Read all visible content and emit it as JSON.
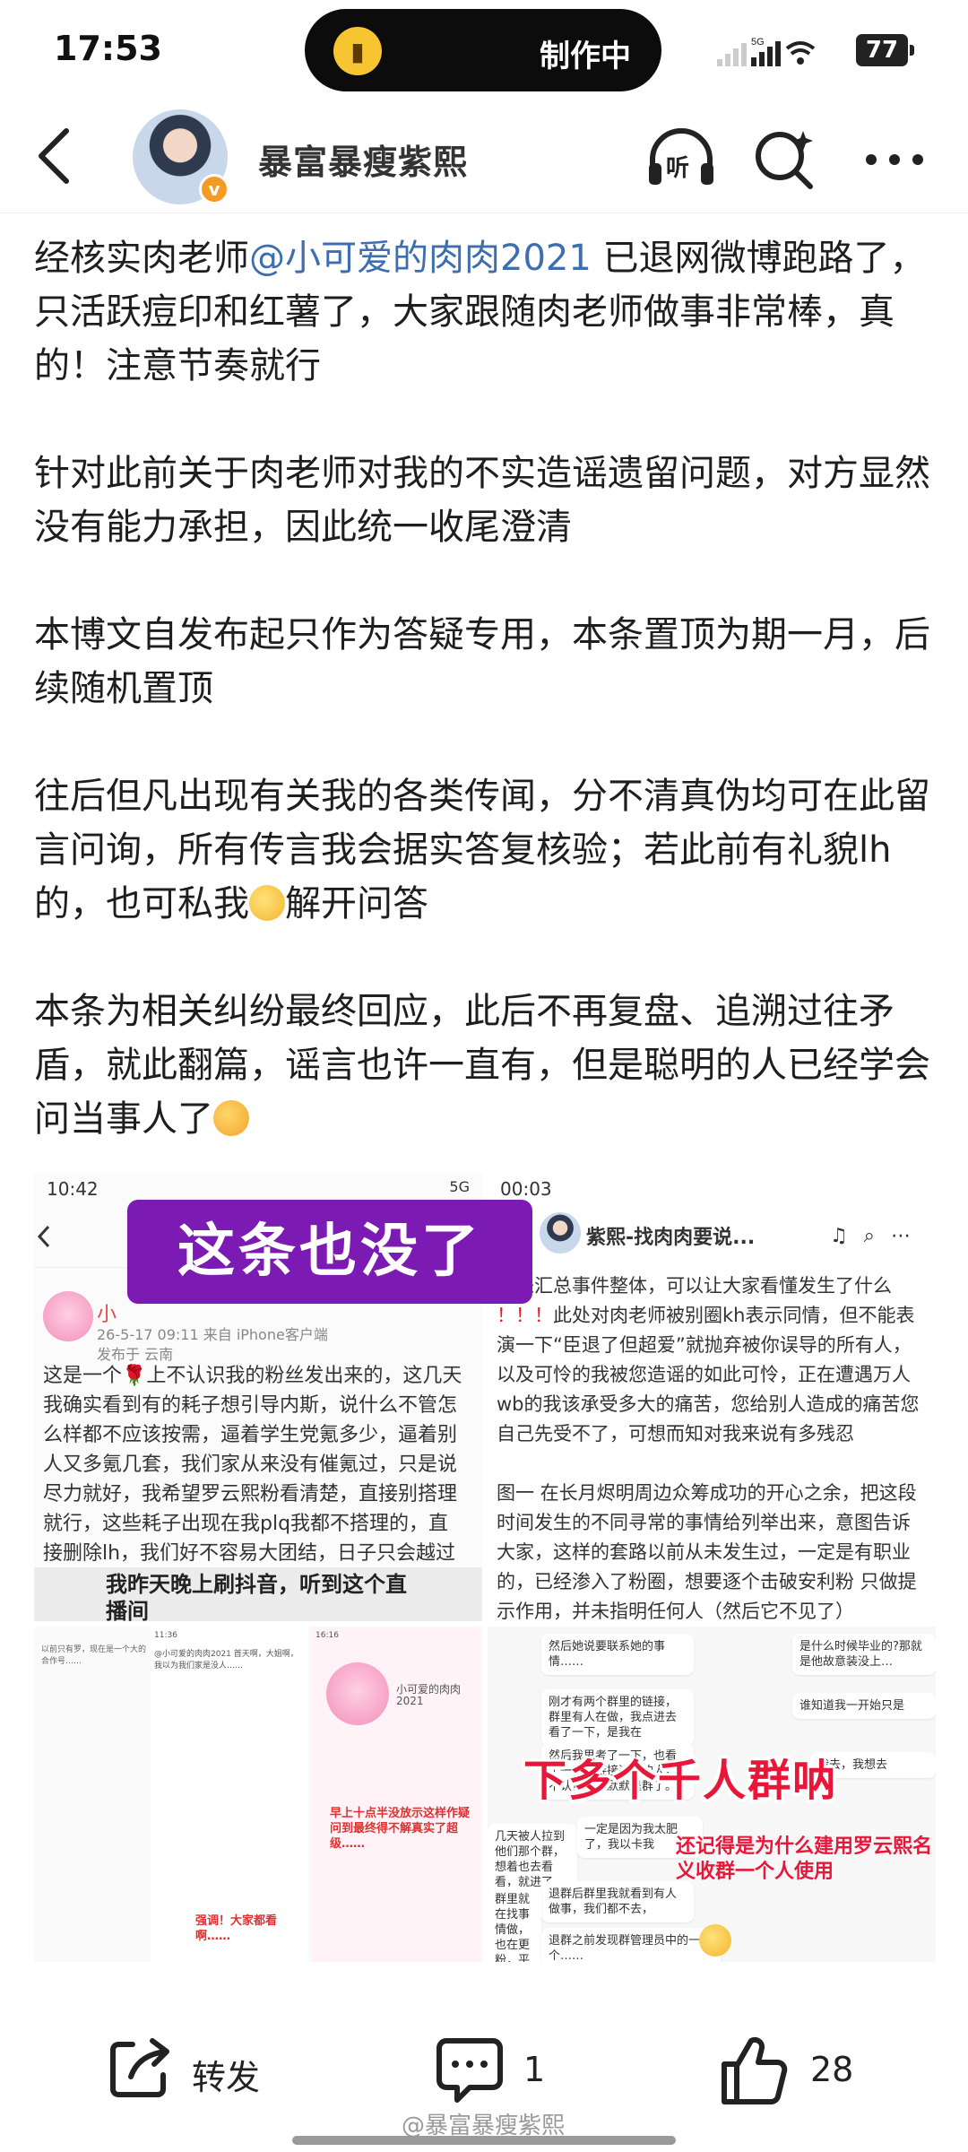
{
  "status_bar": {
    "time": "17:53",
    "pill_text": "制作中",
    "battery": "77"
  },
  "header": {
    "author": "暴富暴瘦紫熙"
  },
  "post": {
    "p1_before": "经核实肉老师",
    "p1_mention": "@小可爱的肉肉2021",
    "p1_after": " 已退网微博跑路了，只活跃痘印和红薯了，大家跟随肉老师做事非常棒，真的！注意节奏就行",
    "p2": "针对此前关于肉老师对我的不实造谣遗留问题，对方显然没有能力承担，因此统一收尾澄清",
    "p3": "本博文自发布起只作为答疑专用，本条置顶为期一月，后续随机置顶",
    "p4_before": "往后但凡出现有关我的各类传闻，分不清真伪均可在此留言问询，所有传言我会据实答复核验；若此前有礼貌lh的，也可私我",
    "p4_after": "解开问答",
    "p5": "本条为相关纠纷最终回应，此后不再复盘、追溯过往矛盾，就此翻篇，谣言也许一直有，但是聪明的人已经学会问当事人了"
  },
  "images": {
    "overlay": "这条也没了",
    "tile1": {
      "time": "10:42",
      "status_right": "5G",
      "name": "小",
      "meta": "26-5-17 09:11  来自 iPhone客户端\n发布于 云南",
      "text": "这是一个🌹上不认识我的粉丝发出来的，这几天我确实看到有的耗子想引导内斯，说什么不管怎么样都不应该按需，逼着学生党氪多少，逼着别人又多氪几套，我们家从来没有催氪过，只是说尽力就好，我希望罗云熙粉看清楚，直接别搭理就行，这些耗子出现在我plq我都不搭理的，直接删除lh，我们好不容易大团结，日子只会越过越好，别上当！",
      "bottom": "我昨天晚上刷抖音，听到这个直播间\n吐槽了我就进去了，然后听得很开"
    },
    "tile2": {
      "time": "00:03",
      "title": "紫熙-找肉肉要说...",
      "text_1": "熙来汇总事件整体，可以让大家看懂发生了什么",
      "text_red": "！！！",
      "text_2": "此处对肉老师被别圈kh表示同情，但不能表演一下“臣退了但超爱”就抛弃被你误导的所有人，以及可怜的我被您造谣的如此可怜，正在遭遇万人wb的我该承受多大的痛苦，您给别人造成的痛苦您自己先受不了，可想而知对我来说有多残忍",
      "text_3": "图一  在长月烬明周边众筹成功的开心之余，把这段时间发生的不同寻常的事情给列举出来，意图告诉大家，这样的套路以前从未发生过，一定是有职业的，已经渗入了粉圈，想要逐个击破安利粉 只做提示作用，并未指明任何人（然后它不见了）"
    },
    "tile3": {
      "time_b": "11:36",
      "time_c": "16:16",
      "name_c": "小可爱的肉肉2021",
      "text_a": "以前只有罗，现在是一个大的合作号……",
      "text_b": "@小可爱的肉肉2021 首天啊，大姐啊，我以为我们家是没人……",
      "red_c": "早上十点半没放示这样作疑问到最终得不解真实了超级……",
      "red_b": "强调！大家都看啊……"
    },
    "tile4": {
      "bubble_1": "然后她说要联系她的事情……",
      "bubble_2": "是什么时候毕业的?那就是他故意装没上…",
      "bubble_3": "刚才有两个群里的链接，群里有人在做，我点进去看了一下，是我在",
      "bubble_4": "谁知道我一开始只是",
      "bubble_5": "然后我思考了一下，也看了一下去链接进群的人，不认识，就默默退群了。",
      "bubble_6": "我去，我想去",
      "big": "下多个千人群呐",
      "red": "还记得是为什么建用罗云熙名义收群一个人使用",
      "bubble_7": "几天被人拉到他们那个群，想着也去看看，就进了。",
      "bubble_8": "一定是因为我太肥了，我以卡我",
      "bubble_9": "退群后群里我就看到有人做事，我们都不去，",
      "bubble_10": "群里就在找事情做，也在更粉，平时",
      "bubble_11": "退群之前发现群管理员中的一个……"
    }
  },
  "bottom_bar": {
    "share_label": "转发",
    "comment_count": "1",
    "like_count": "28"
  },
  "watermark": "@暴富暴瘦紫熙"
}
